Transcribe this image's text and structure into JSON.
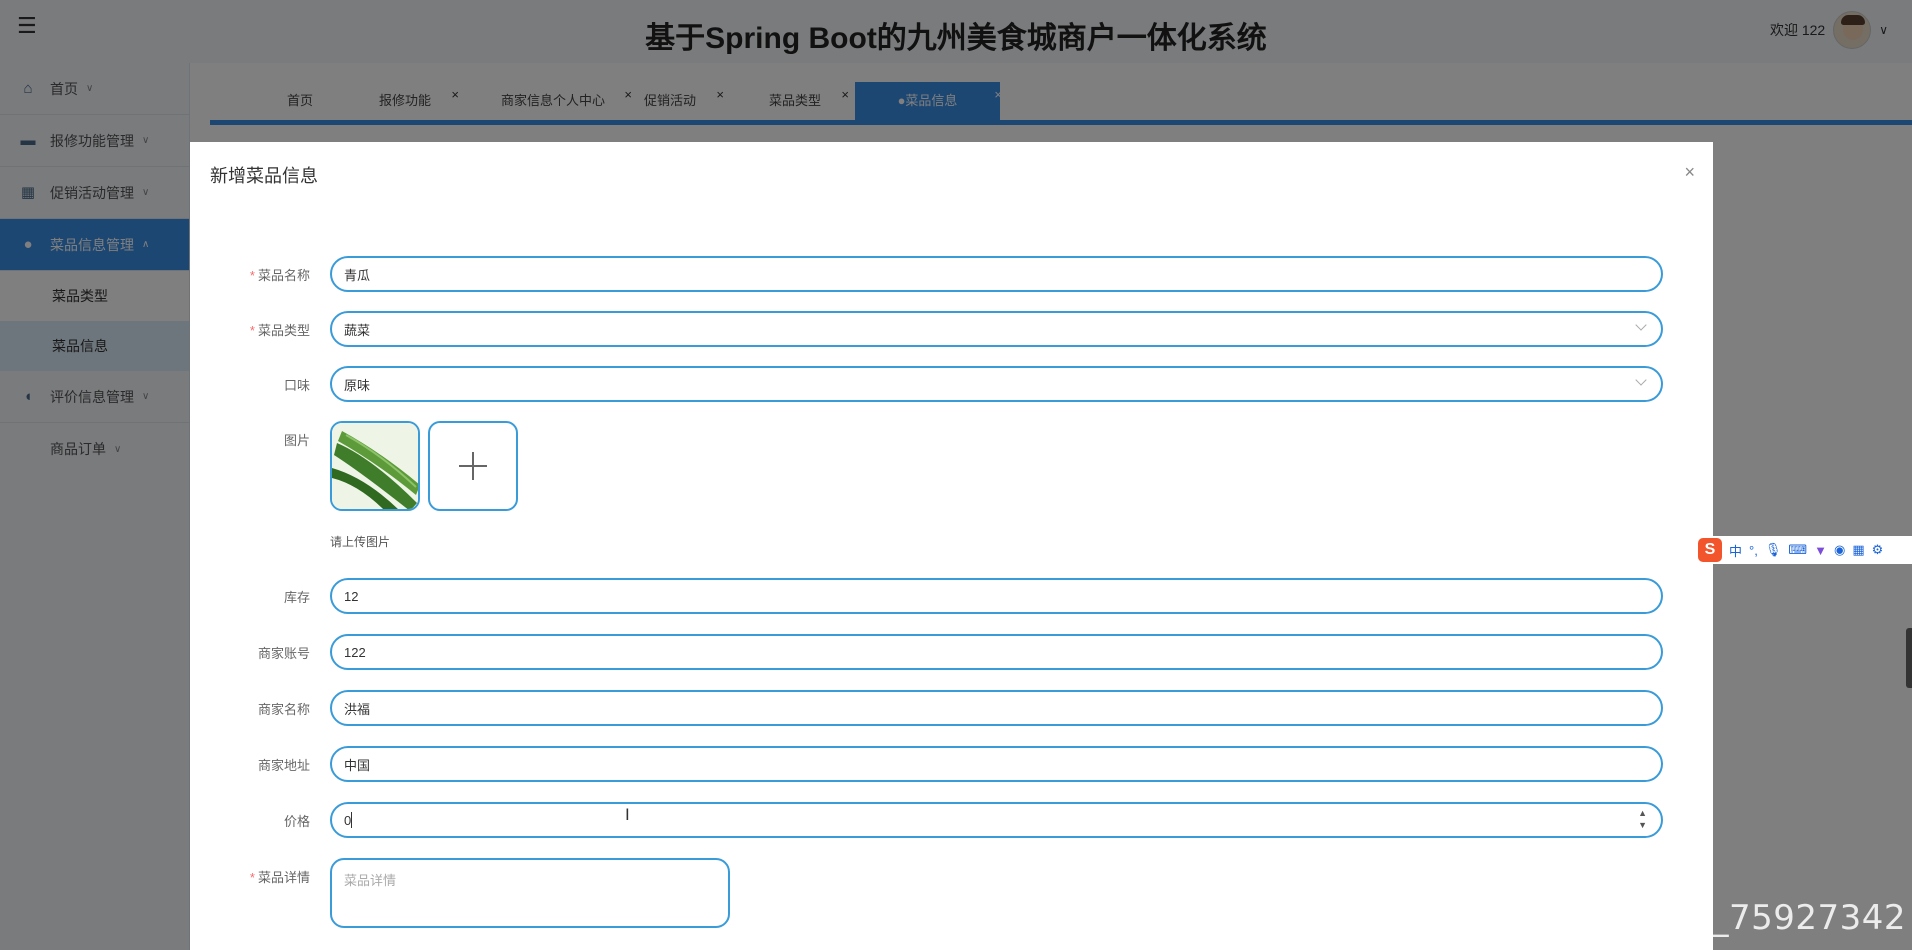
{
  "header": {
    "title": "基于Spring Boot的九州美食城商户一体化系统",
    "welcome": "欢迎 122",
    "menu_icon": "hamburger-icon"
  },
  "sidebar": {
    "items": [
      {
        "label": "首页",
        "icon": "home-icon"
      },
      {
        "label": "报修功能管理",
        "icon": "folder-icon"
      },
      {
        "label": "促销活动管理",
        "icon": "grid-icon"
      },
      {
        "label": "菜品信息管理",
        "icon": "dish-icon"
      },
      {
        "label": "评价信息管理",
        "icon": "comment-icon"
      },
      {
        "label": "商品订单"
      }
    ],
    "sub_items": [
      "菜品类型",
      "菜品信息"
    ]
  },
  "tabs": [
    {
      "label": "首页"
    },
    {
      "label": "报修功能"
    },
    {
      "label": "商家信息个人中心"
    },
    {
      "label": "促销活动"
    },
    {
      "label": "菜品类型"
    },
    {
      "label": "●菜品信息"
    }
  ],
  "dialog": {
    "title": "新增菜品信息",
    "fields": {
      "name": {
        "label": "菜品名称",
        "value": "青瓜",
        "required": true
      },
      "type": {
        "label": "菜品类型",
        "value": "蔬菜",
        "required": true
      },
      "flavor": {
        "label": "口味",
        "value": "原味"
      },
      "image": {
        "label": "图片",
        "tip": "请上传图片"
      },
      "stock": {
        "label": "库存",
        "value": "12"
      },
      "merchant_account": {
        "label": "商家账号",
        "value": "122"
      },
      "merchant_name": {
        "label": "商家名称",
        "value": "洪福"
      },
      "merchant_address": {
        "label": "商家地址",
        "value": "中国"
      },
      "price": {
        "label": "价格",
        "value": "0"
      },
      "detail": {
        "label": "菜品详情",
        "placeholder": "菜品详情",
        "required": true
      }
    }
  },
  "ime": {
    "logo": "S",
    "mode": "中",
    "punct": "°,"
  },
  "watermark": "CSDN @2201_75927342"
}
